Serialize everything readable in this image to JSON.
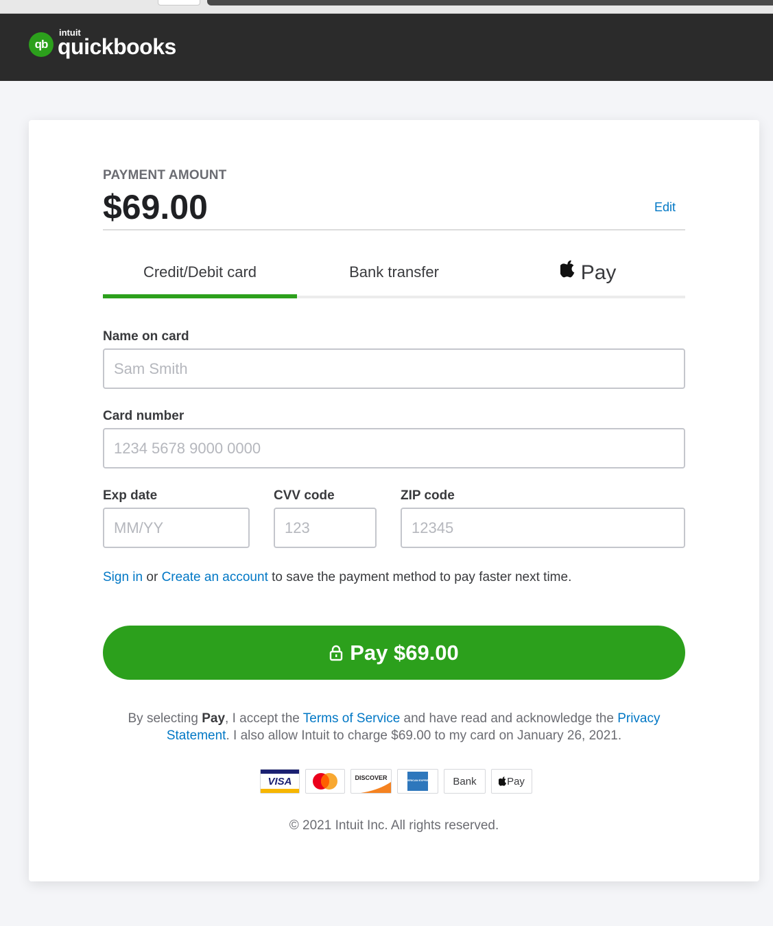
{
  "brand": {
    "mark": "qb",
    "intuit": "intuit",
    "name": "quickbooks",
    "accent_color": "#2ca01c",
    "link_color": "#0077c5"
  },
  "payment": {
    "amount_label": "PAYMENT AMOUNT",
    "amount": "$69.00",
    "edit_label": "Edit"
  },
  "tabs": [
    {
      "label": "Credit/Debit card",
      "active": true
    },
    {
      "label": "Bank transfer",
      "active": false
    },
    {
      "label": "Pay",
      "icon": "apple-icon",
      "active": false
    }
  ],
  "form": {
    "name": {
      "label": "Name on card",
      "placeholder": "Sam Smith",
      "value": ""
    },
    "card_number": {
      "label": "Card number",
      "placeholder": "1234 5678 9000 0000",
      "value": ""
    },
    "exp_date": {
      "label": "Exp date",
      "placeholder": "MM/YY",
      "value": ""
    },
    "cvv": {
      "label": "CVV code",
      "placeholder": "123",
      "value": ""
    },
    "zip": {
      "label": "ZIP code",
      "placeholder": "12345",
      "value": ""
    }
  },
  "signin": {
    "sign_in": "Sign in",
    "or": "or",
    "create_account": "Create an account",
    "rest": "to save the payment method to pay faster next time."
  },
  "pay_button": {
    "label": "Pay $69.00",
    "icon": "lock-icon"
  },
  "legal": {
    "part1": "By selecting",
    "pay_word": "Pay",
    "part2": ", I accept the",
    "terms": "Terms of Service",
    "part3": "and have read and acknowledge the",
    "privacy": "Privacy Statement",
    "part4": ". I also allow Intuit to charge $69.00 to my card on January 26, 2021."
  },
  "payment_methods": {
    "visa": "VISA",
    "discover": "DISCOVER",
    "amex": "AMERICAN EXPRESS",
    "bank": "Bank",
    "apple_pay": "Pay"
  },
  "footer": {
    "copyright": "© 2021 Intuit Inc. All rights reserved."
  }
}
